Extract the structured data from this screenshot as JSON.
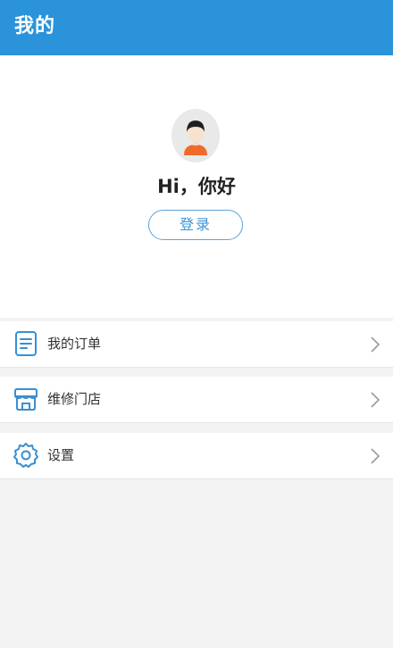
{
  "header": {
    "title": "我的"
  },
  "profile": {
    "avatar": "avatar-icon",
    "greeting": "Hi，你好",
    "login_label": "登录"
  },
  "menu": {
    "items": [
      {
        "label": "我的订单",
        "icon": "document-icon"
      },
      {
        "label": "维修门店",
        "icon": "store-icon"
      },
      {
        "label": "设置",
        "icon": "gear-icon"
      }
    ]
  },
  "colors": {
    "primary": "#2a93d9",
    "icon": "#3a8fd0",
    "background": "#f3f3f3",
    "avatar_shirt": "#f06a2b"
  }
}
